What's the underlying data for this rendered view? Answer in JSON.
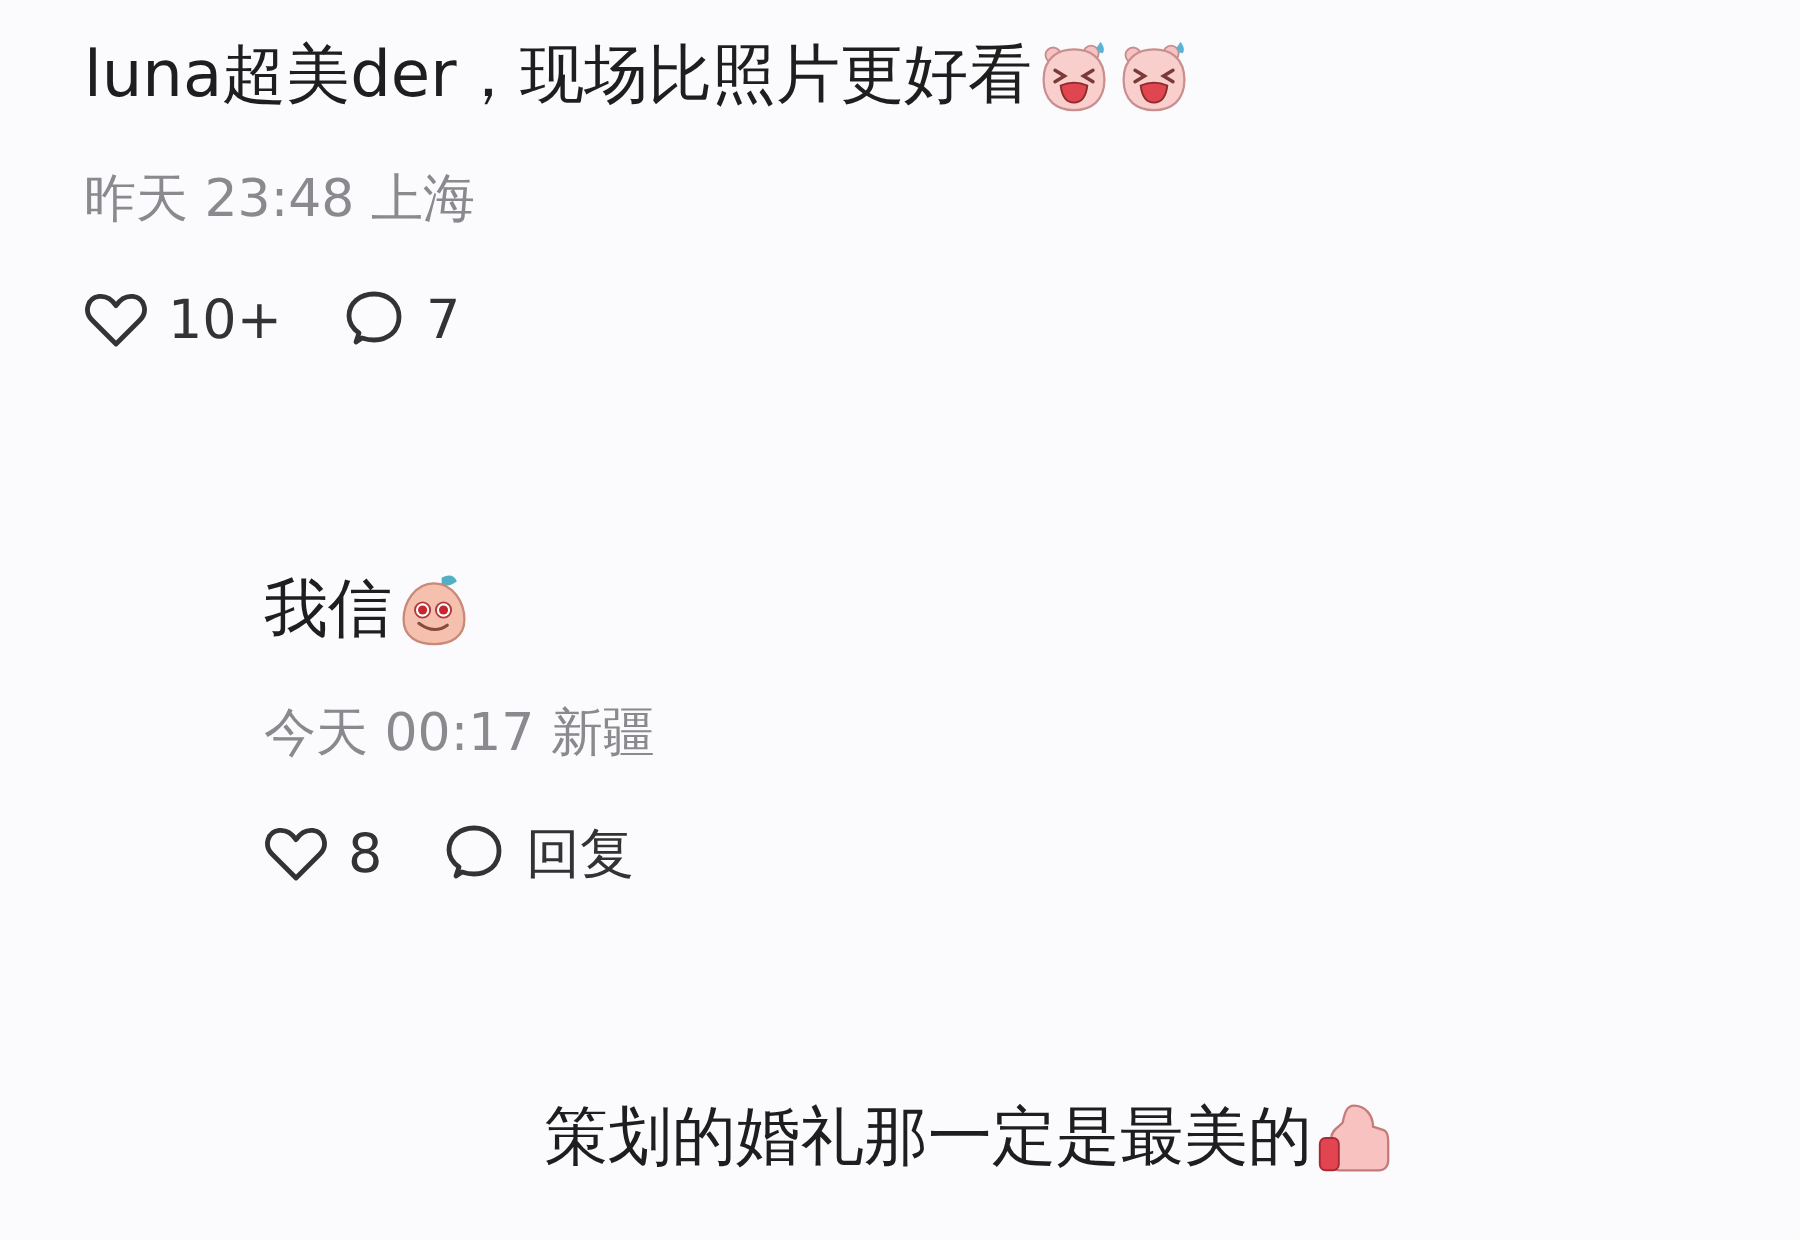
{
  "comments": [
    {
      "text": "luna超美der，现场比照片更好看",
      "stickers": [
        {
          "kind": "laughing"
        },
        {
          "kind": "laughing"
        }
      ],
      "meta": "昨天 23:48 上海",
      "actions": [
        {
          "kind": "like",
          "label": "10+"
        },
        {
          "kind": "comment",
          "label": "7"
        }
      ],
      "children": [
        {
          "text": "我信",
          "stickers": [
            {
              "kind": "peach"
            }
          ],
          "meta": "今天 00:17 新疆",
          "actions": [
            {
              "kind": "like",
              "label": "8"
            },
            {
              "kind": "comment",
              "label": "回复"
            }
          ],
          "children": [
            {
              "text": "策划的婚礼那一定是最美的",
              "stickers": [
                {
                  "kind": "thumbs"
                }
              ]
            }
          ]
        }
      ]
    }
  ]
}
